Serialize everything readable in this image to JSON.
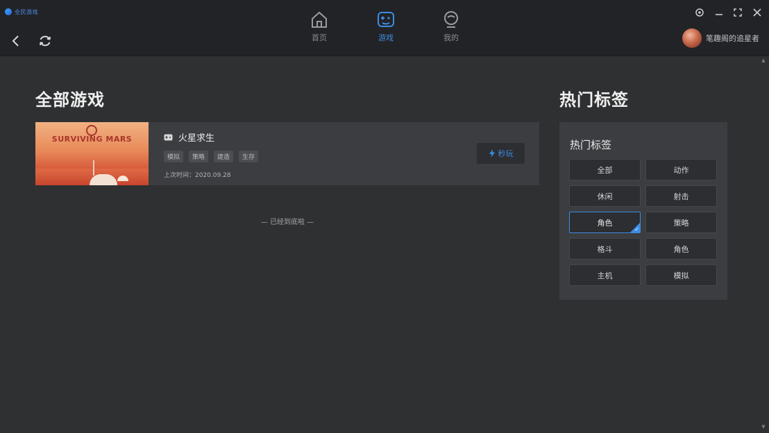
{
  "app": {
    "logo_text": "全民游戏"
  },
  "tabs": [
    {
      "label": "首页",
      "icon": "home-icon",
      "active": false
    },
    {
      "label": "游戏",
      "icon": "gamepad-icon",
      "active": true
    },
    {
      "label": "我的",
      "icon": "profile-icon",
      "active": false
    }
  ],
  "user": {
    "name": "笔趣阁的追星者"
  },
  "main": {
    "title": "全部游戏",
    "games": [
      {
        "name": "火星求生",
        "cover_text": "SURVIVING MARS",
        "tags": [
          "模拟",
          "策略",
          "建造",
          "生存"
        ],
        "launch_time": "上次时间：2020.09.28",
        "start_label": "秒玩"
      }
    ],
    "end_message": "— 已经到底啦 —"
  },
  "sidebar": {
    "title": "热门标签",
    "panel_title": "热门标签",
    "tags": [
      "全部",
      "动作",
      "休闲",
      "射击",
      "角色",
      "策略",
      "格斗",
      "角色",
      "主机",
      "模拟"
    ],
    "selected_index": 4
  },
  "colors": {
    "accent": "#3d8de6",
    "background": "#2f3032",
    "card": "#3b3d40",
    "titlebar": "#222326"
  }
}
